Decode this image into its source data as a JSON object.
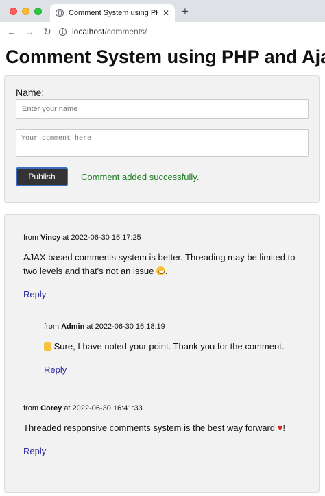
{
  "browser": {
    "tab_title": "Comment System using PHP a",
    "tab_close": "✕",
    "new_tab": "+",
    "back": "←",
    "forward": "→",
    "reload": "↻",
    "info": "i",
    "url_host": "localhost",
    "url_path": "/comments/"
  },
  "page": {
    "title": "Comment System using PHP and Ajax"
  },
  "form": {
    "name_label": "Name:",
    "name_placeholder": "Enter your name",
    "name_value": "",
    "comment_placeholder": "Your comment here",
    "comment_value": "",
    "publish_label": "Publish",
    "status_message": "Comment added successfully.",
    "status_color": "#1e7d22"
  },
  "comments": [
    {
      "from_label": "from",
      "author": "Vincy",
      "at_label": "at",
      "timestamp": "2022-06-30 16:17:25",
      "text": "AJAX based comments system is better. Threading may be limited to two levels and that's not an issue",
      "emoji": "grinning-face-icon",
      "text_suffix": ".",
      "reply_label": "Reply"
    },
    {
      "from_label": "from",
      "author": "Admin",
      "at_label": "at",
      "timestamp": "2022-06-30 16:18:19",
      "emoji": "thumbs-up-icon",
      "text": " Sure, I have noted your point. Thank you for the comment.",
      "reply_label": "Reply"
    },
    {
      "from_label": "from",
      "author": "Corey",
      "at_label": "at",
      "timestamp": "2022-06-30 16:41:33",
      "text": "Threaded responsive comments system is the best way forward ",
      "emoji": "red-heart-icon",
      "text_suffix": "!",
      "reply_label": "Reply"
    }
  ],
  "colors": {
    "link": "#2a2aa0",
    "panel_bg": "#f2f2f2",
    "button_bg": "#333333"
  }
}
